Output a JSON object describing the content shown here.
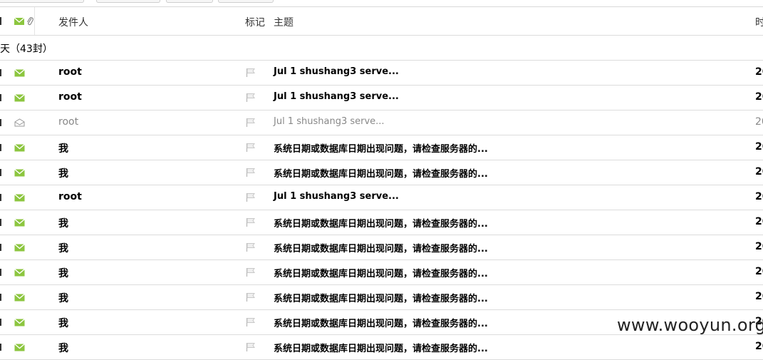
{
  "header": {
    "flag_col": "标记",
    "sender_col": "发件人",
    "subject_col": "主题",
    "time_col": "时"
  },
  "group": {
    "label": "天（43封）"
  },
  "rows": [
    {
      "sender": "root",
      "subject": "Jul 1 shushang3 serve...",
      "time": "20",
      "read": false
    },
    {
      "sender": "root",
      "subject": "Jul 1 shushang3 serve...",
      "time": "20",
      "read": false
    },
    {
      "sender": "root",
      "subject": "Jul 1 shushang3 serve...",
      "time": "20",
      "read": true
    },
    {
      "sender": "我",
      "subject": "系统日期或数据库日期出现问题，请检查服务器的...",
      "time": "20",
      "read": false
    },
    {
      "sender": "我",
      "subject": "系统日期或数据库日期出现问题，请检查服务器的...",
      "time": "20",
      "read": false
    },
    {
      "sender": "root",
      "subject": "Jul 1 shushang3 serve...",
      "time": "20",
      "read": false
    },
    {
      "sender": "我",
      "subject": "系统日期或数据库日期出现问题，请检查服务器的...",
      "time": "20",
      "read": false
    },
    {
      "sender": "我",
      "subject": "系统日期或数据库日期出现问题，请检查服务器的...",
      "time": "20",
      "read": false
    },
    {
      "sender": "我",
      "subject": "系统日期或数据库日期出现问题，请检查服务器的...",
      "time": "20",
      "read": false
    },
    {
      "sender": "我",
      "subject": "系统日期或数据库日期出现问题，请检查服务器的...",
      "time": "20",
      "read": false
    },
    {
      "sender": "我",
      "subject": "系统日期或数据库日期出现问题，请检查服务器的...",
      "time": "20",
      "read": false
    },
    {
      "sender": "我",
      "subject": "系统日期或数据库日期出现问题，请检查服务器的...",
      "time": "20",
      "read": false
    }
  ],
  "watermark": "www.wooyun.org",
  "colors": {
    "unread_icon": "#8cc63f",
    "read_icon": "#999999",
    "read_text": "#888888"
  },
  "icons": {
    "unread": "envelope-closed-icon",
    "read": "envelope-open-icon",
    "flag": "flag-icon",
    "attachment": "paperclip-icon"
  }
}
